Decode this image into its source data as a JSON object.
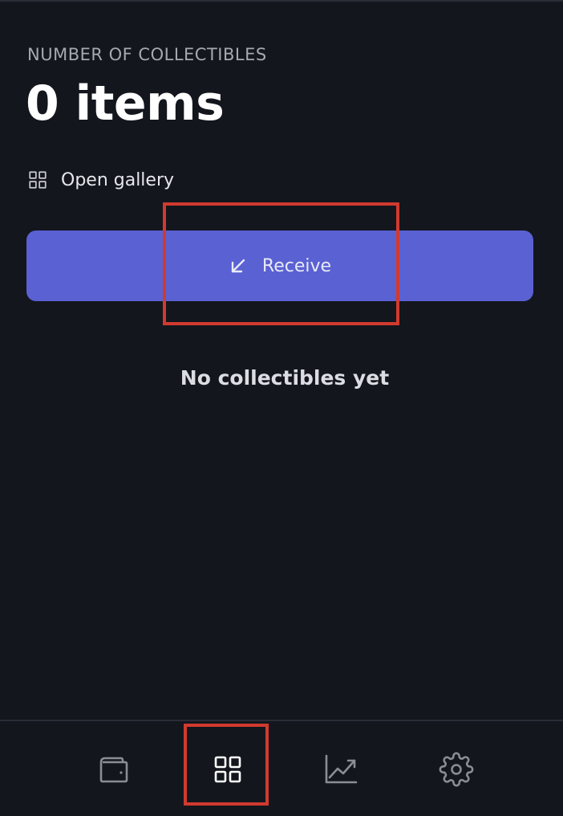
{
  "collectibles": {
    "count_label": "NUMBER OF COLLECTIBLES",
    "count_value": "0 items",
    "open_gallery_label": "Open gallery",
    "open_gallery_icon": "grid-icon",
    "receive_label": "Receive",
    "receive_icon": "arrow-down-left-icon",
    "empty_message": "No collectibles yet"
  },
  "bottom_nav": {
    "items": [
      {
        "name": "wallet",
        "icon": "wallet-icon",
        "active": false
      },
      {
        "name": "collectibles",
        "icon": "grid-icon",
        "active": true
      },
      {
        "name": "chart",
        "icon": "chart-icon",
        "active": false
      },
      {
        "name": "settings",
        "icon": "gear-icon",
        "active": false
      }
    ]
  },
  "colors": {
    "background": "#14161d",
    "accent": "#5a61d3",
    "highlight": "#d13a2f",
    "active_icon": "#ffffff",
    "inactive_icon": "#8a8d96"
  }
}
